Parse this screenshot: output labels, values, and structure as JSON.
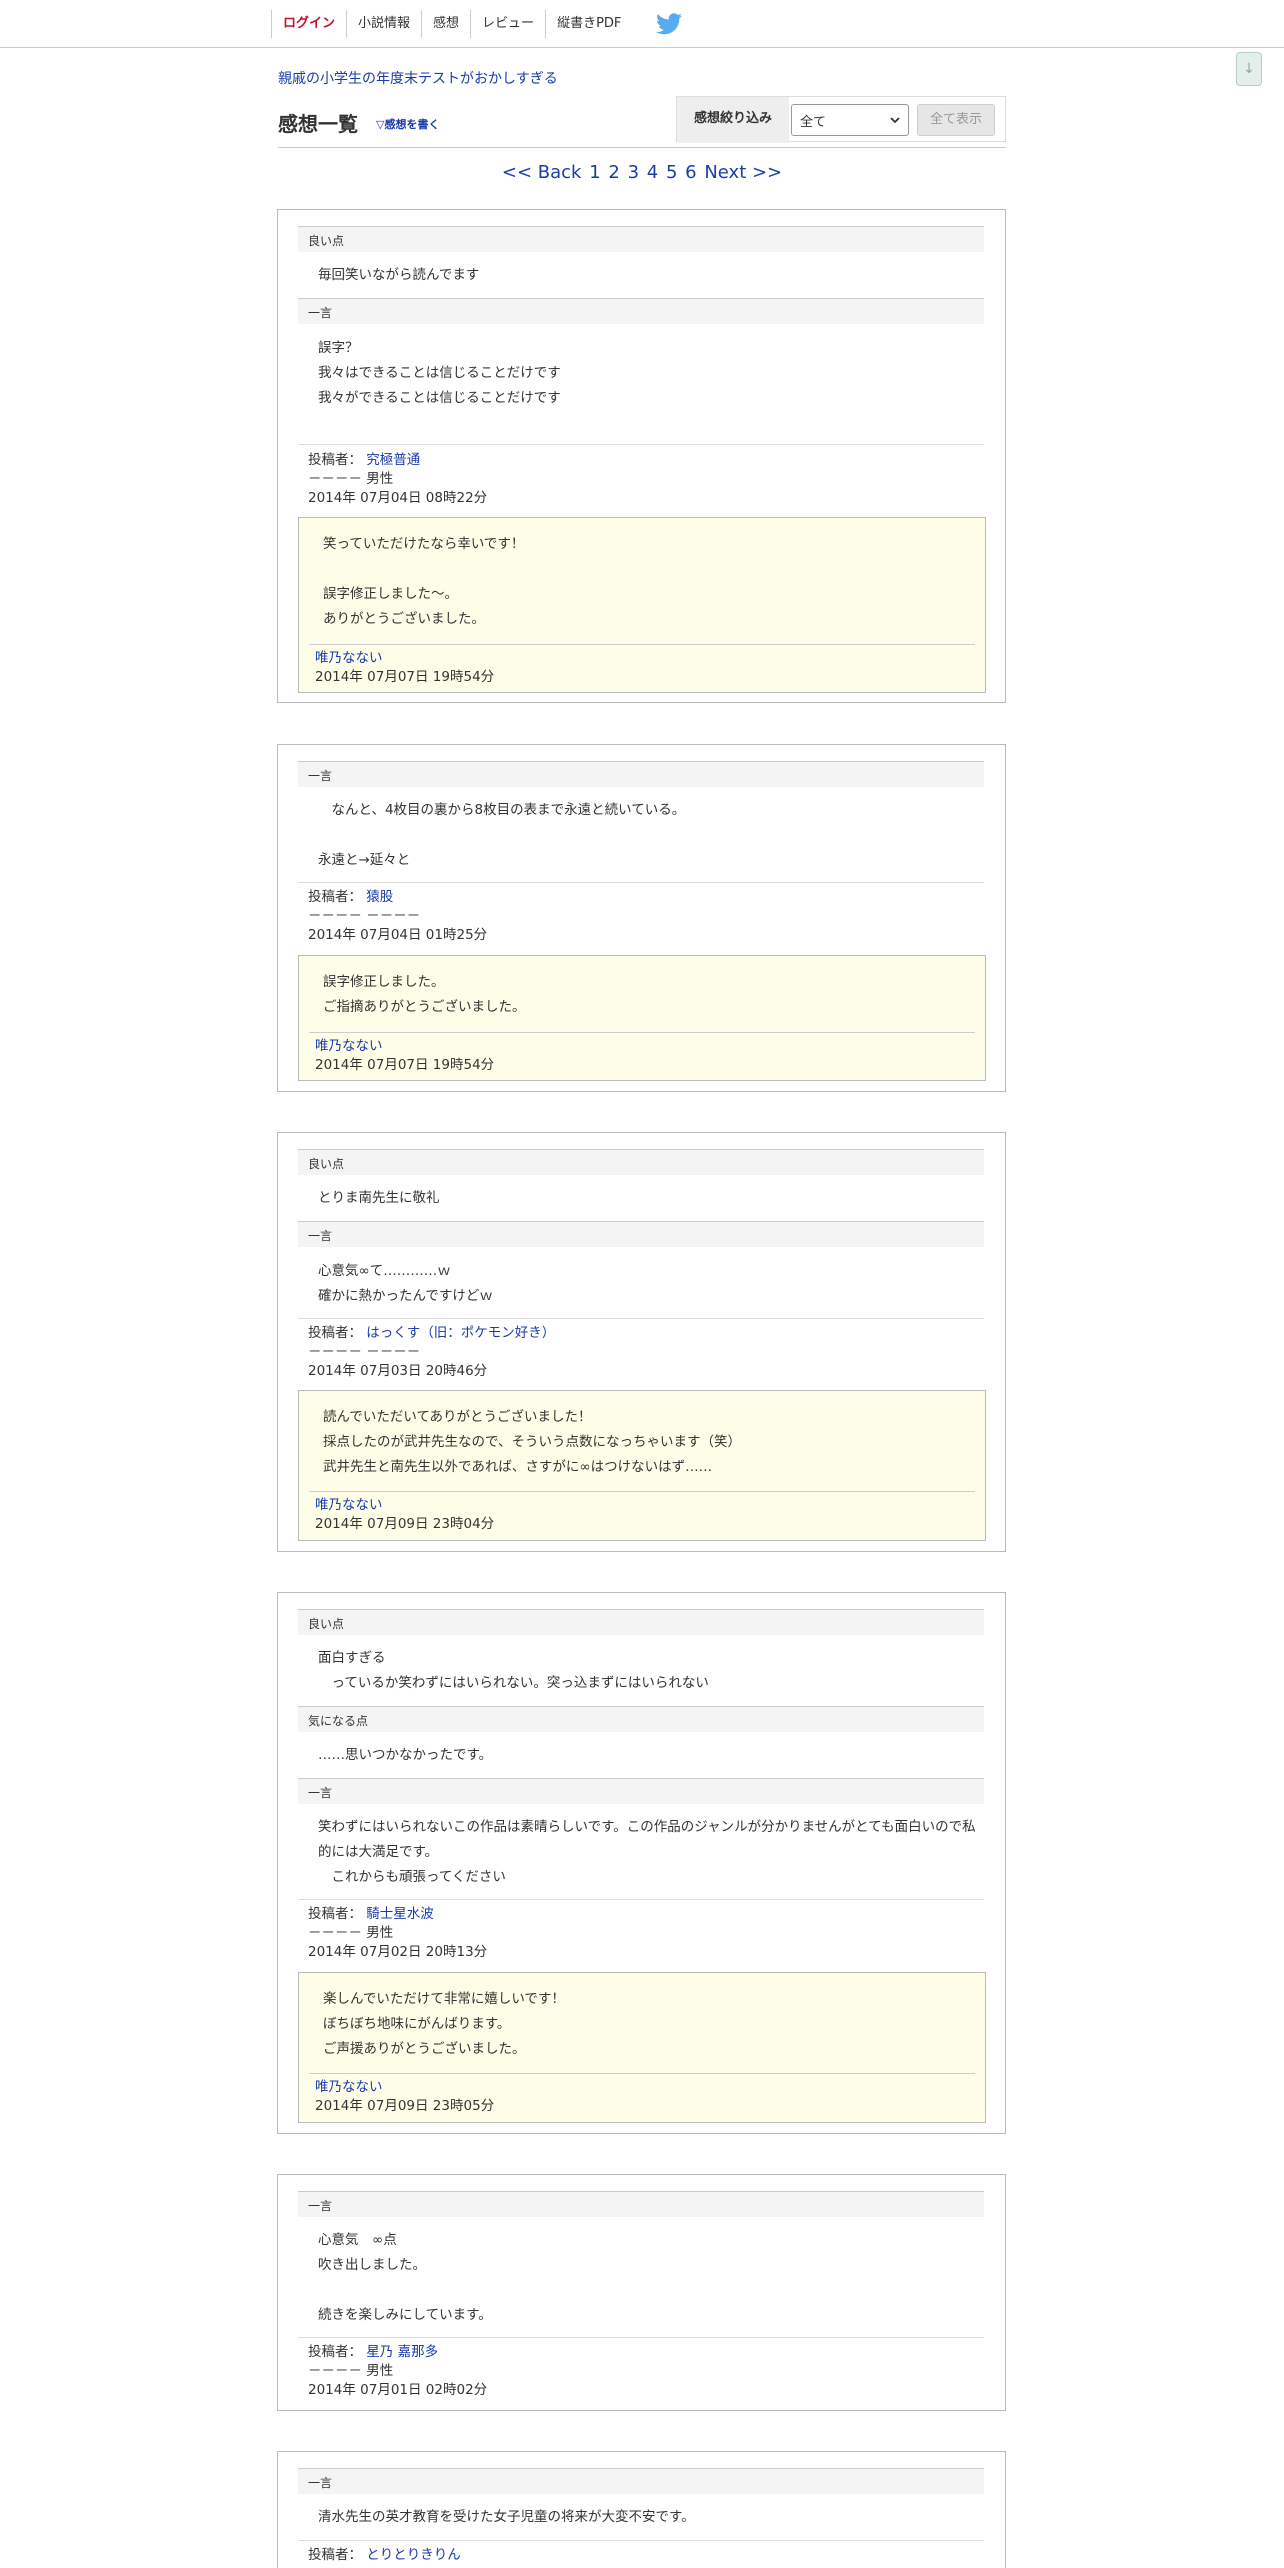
{
  "nav": {
    "items": [
      "ログイン",
      "小説情報",
      "感想",
      "レビュー",
      "縦書きPDF"
    ],
    "twitter_icon": "twitter-bird-icon"
  },
  "scroll_button": "↓",
  "novel_title": "親戚の小学生の年度末テストがおかしすぎる",
  "page_title": "感想一覧",
  "write_link": "▽感想を書く",
  "filter": {
    "label": "感想絞り込み",
    "selected": "全て",
    "button": "全て表示"
  },
  "pager": {
    "back": "<< Back",
    "pages": [
      "1",
      "2",
      "3",
      "4",
      "5",
      "6"
    ],
    "next": "Next >>"
  },
  "labels": {
    "good": "良い点",
    "concern": "気になる点",
    "comment": "一言",
    "poster": "投稿者："
  },
  "reviews": [
    {
      "good": [
        "毎回笑いながら読んでます"
      ],
      "comment": [
        "誤字？",
        "我々はできることは信じることだけです",
        "我々ができることは信じることだけです"
      ],
      "author": "究極普通",
      "profile": "－－－－ 男性",
      "date": "2014年 07月04日 08時22分",
      "reply": [
        "笑っていただけたなら幸いです！",
        "",
        "誤字修正しました～。",
        "ありがとうございました。"
      ],
      "reply_author": "唯乃なない",
      "reply_date": "2014年 07月07日 19時54分"
    },
    {
      "comment": [
        "　なんと、4枚目の裏から8枚目の表まで永遠と続いている。",
        "",
        "永遠と→延々と"
      ],
      "author": "猿股",
      "profile": "－－－－ －－－－",
      "date": "2014年 07月04日 01時25分",
      "reply": [
        "誤字修正しました。",
        "ご指摘ありがとうございました。"
      ],
      "reply_author": "唯乃なない",
      "reply_date": "2014年 07月07日 19時54分"
    },
    {
      "good": [
        "とりま南先生に敬礼"
      ],
      "comment": [
        "心意気∞て…………ｗ",
        "確かに熱かったんですけどｗ"
      ],
      "author": "はっくす（旧：ポケモン好き）",
      "profile": "－－－－ －－－－",
      "date": "2014年 07月03日 20時46分",
      "reply": [
        "読んでいただいてありがとうございました！",
        "採点したのが武井先生なので、そういう点数になっちゃいます（笑）",
        "武井先生と南先生以外であれば、さすがに∞はつけないはず……"
      ],
      "reply_author": "唯乃なない",
      "reply_date": "2014年 07月09日 23時04分"
    },
    {
      "good": [
        "面白すぎる",
        "　っているか笑わずにはいられない。突っ込まずにはいられない"
      ],
      "concern": [
        "……思いつかなかったです。"
      ],
      "comment": [
        "笑わずにはいられないこの作品は素晴らしいです。この作品のジャンルが分かりませんがとても面白いので私的には大満足です。",
        "　これからも頑張ってください"
      ],
      "author": "騎士星水波",
      "profile": "－－－－ 男性",
      "date": "2014年 07月02日 20時13分",
      "reply": [
        "楽しんでいただけて非常に嬉しいです！",
        "ぼちぼち地味にがんばります。",
        "ご声援ありがとうございました。"
      ],
      "reply_author": "唯乃なない",
      "reply_date": "2014年 07月09日 23時05分"
    },
    {
      "comment": [
        "心意気　∞点",
        "吹き出しました。",
        "",
        "続きを楽しみにしています。"
      ],
      "author": "星乃 嘉那多",
      "profile": "－－－－ 男性",
      "date": "2014年 07月01日 02時02分"
    },
    {
      "comment": [
        "清水先生の英才教育を受けた女子児童の将来が大変不安です。"
      ],
      "author": "とりとりきりん"
    }
  ]
}
